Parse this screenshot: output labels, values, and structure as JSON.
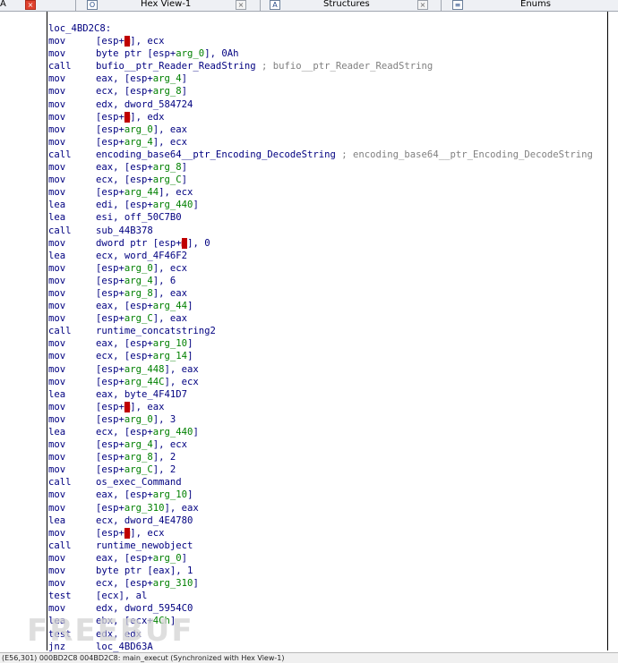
{
  "tabs": {
    "left": {
      "title": "A"
    },
    "hex": {
      "title": "Hex View-1",
      "icon_glyph": "O",
      "close_glyph": "×"
    },
    "structures": {
      "title": "Structures",
      "icon_glyph": "A",
      "close_glyph": "×"
    },
    "enums": {
      "title": "Enums",
      "icon_glyph": "≡"
    },
    "active_close_glyph": "×"
  },
  "colors": {
    "instruction": "#000080",
    "variable": "#008000",
    "comment": "#808080",
    "highlight": "#c00000"
  },
  "code": {
    "label": "loc_4BD2C8:",
    "instructions": [
      {
        "mnemonic": "mov",
        "operand": [
          [
            "p",
            "[esp+"
          ],
          [
            "m",
            "■"
          ],
          [
            "p",
            "], ecx"
          ]
        ]
      },
      {
        "mnemonic": "mov",
        "operand": [
          [
            "p",
            "byte ptr [esp+"
          ],
          [
            "v",
            "arg_0"
          ],
          [
            "p",
            "], 0Ah"
          ]
        ]
      },
      {
        "mnemonic": "call",
        "operand": [
          [
            "p",
            "bufio__ptr_Reader_ReadString "
          ],
          [
            "c",
            "; bufio__ptr_Reader_ReadString"
          ]
        ]
      },
      {
        "mnemonic": "mov",
        "operand": [
          [
            "p",
            "eax, [esp+"
          ],
          [
            "v",
            "arg_4"
          ],
          [
            "p",
            "]"
          ]
        ]
      },
      {
        "mnemonic": "mov",
        "operand": [
          [
            "p",
            "ecx, [esp+"
          ],
          [
            "v",
            "arg_8"
          ],
          [
            "p",
            "]"
          ]
        ]
      },
      {
        "mnemonic": "mov",
        "operand": [
          [
            "p",
            "edx, dword_584724"
          ]
        ]
      },
      {
        "mnemonic": "mov",
        "operand": [
          [
            "p",
            "[esp+"
          ],
          [
            "m",
            "■"
          ],
          [
            "p",
            "], edx"
          ]
        ]
      },
      {
        "mnemonic": "mov",
        "operand": [
          [
            "p",
            "[esp+"
          ],
          [
            "v",
            "arg_0"
          ],
          [
            "p",
            "], eax"
          ]
        ]
      },
      {
        "mnemonic": "mov",
        "operand": [
          [
            "p",
            "[esp+"
          ],
          [
            "v",
            "arg_4"
          ],
          [
            "p",
            "], ecx"
          ]
        ]
      },
      {
        "mnemonic": "call",
        "operand": [
          [
            "p",
            "encoding_base64__ptr_Encoding_DecodeString "
          ],
          [
            "c",
            "; encoding_base64__ptr_Encoding_DecodeString"
          ]
        ]
      },
      {
        "mnemonic": "mov",
        "operand": [
          [
            "p",
            "eax, [esp+"
          ],
          [
            "v",
            "arg_8"
          ],
          [
            "p",
            "]"
          ]
        ]
      },
      {
        "mnemonic": "mov",
        "operand": [
          [
            "p",
            "ecx, [esp+"
          ],
          [
            "v",
            "arg_C"
          ],
          [
            "p",
            "]"
          ]
        ]
      },
      {
        "mnemonic": "mov",
        "operand": [
          [
            "p",
            "[esp+"
          ],
          [
            "v",
            "arg_44"
          ],
          [
            "p",
            "], ecx"
          ]
        ]
      },
      {
        "mnemonic": "lea",
        "operand": [
          [
            "p",
            "edi, [esp+"
          ],
          [
            "v",
            "arg_440"
          ],
          [
            "p",
            "]"
          ]
        ]
      },
      {
        "mnemonic": "lea",
        "operand": [
          [
            "p",
            "esi, off_50C7B0"
          ]
        ]
      },
      {
        "mnemonic": "call",
        "operand": [
          [
            "p",
            "sub_44B378"
          ]
        ]
      },
      {
        "mnemonic": "mov",
        "operand": [
          [
            "p",
            "dword ptr [esp+"
          ],
          [
            "m",
            "■"
          ],
          [
            "p",
            "], 0"
          ]
        ]
      },
      {
        "mnemonic": "lea",
        "operand": [
          [
            "p",
            "ecx, word_4F46F2"
          ]
        ]
      },
      {
        "mnemonic": "mov",
        "operand": [
          [
            "p",
            "[esp+"
          ],
          [
            "v",
            "arg_0"
          ],
          [
            "p",
            "], ecx"
          ]
        ]
      },
      {
        "mnemonic": "mov",
        "operand": [
          [
            "p",
            "[esp+"
          ],
          [
            "v",
            "arg_4"
          ],
          [
            "p",
            "], 6"
          ]
        ]
      },
      {
        "mnemonic": "mov",
        "operand": [
          [
            "p",
            "[esp+"
          ],
          [
            "v",
            "arg_8"
          ],
          [
            "p",
            "], eax"
          ]
        ]
      },
      {
        "mnemonic": "mov",
        "operand": [
          [
            "p",
            "eax, [esp+"
          ],
          [
            "v",
            "arg_44"
          ],
          [
            "p",
            "]"
          ]
        ]
      },
      {
        "mnemonic": "mov",
        "operand": [
          [
            "p",
            "[esp+"
          ],
          [
            "v",
            "arg_C"
          ],
          [
            "p",
            "], eax"
          ]
        ]
      },
      {
        "mnemonic": "call",
        "operand": [
          [
            "p",
            "runtime_concatstring2"
          ]
        ]
      },
      {
        "mnemonic": "mov",
        "operand": [
          [
            "p",
            "eax, [esp+"
          ],
          [
            "v",
            "arg_10"
          ],
          [
            "p",
            "]"
          ]
        ]
      },
      {
        "mnemonic": "mov",
        "operand": [
          [
            "p",
            "ecx, [esp+"
          ],
          [
            "v",
            "arg_14"
          ],
          [
            "p",
            "]"
          ]
        ]
      },
      {
        "mnemonic": "mov",
        "operand": [
          [
            "p",
            "[esp+"
          ],
          [
            "v",
            "arg_448"
          ],
          [
            "p",
            "], eax"
          ]
        ]
      },
      {
        "mnemonic": "mov",
        "operand": [
          [
            "p",
            "[esp+"
          ],
          [
            "v",
            "arg_44C"
          ],
          [
            "p",
            "], ecx"
          ]
        ]
      },
      {
        "mnemonic": "lea",
        "operand": [
          [
            "p",
            "eax, byte_4F41D7"
          ]
        ]
      },
      {
        "mnemonic": "mov",
        "operand": [
          [
            "p",
            "[esp+"
          ],
          [
            "m",
            "■"
          ],
          [
            "p",
            "], eax"
          ]
        ]
      },
      {
        "mnemonic": "mov",
        "operand": [
          [
            "p",
            "[esp+"
          ],
          [
            "v",
            "arg_0"
          ],
          [
            "p",
            "], 3"
          ]
        ]
      },
      {
        "mnemonic": "lea",
        "operand": [
          [
            "p",
            "ecx, [esp+"
          ],
          [
            "v",
            "arg_440"
          ],
          [
            "p",
            "]"
          ]
        ]
      },
      {
        "mnemonic": "mov",
        "operand": [
          [
            "p",
            "[esp+"
          ],
          [
            "v",
            "arg_4"
          ],
          [
            "p",
            "], ecx"
          ]
        ]
      },
      {
        "mnemonic": "mov",
        "operand": [
          [
            "p",
            "[esp+"
          ],
          [
            "v",
            "arg_8"
          ],
          [
            "p",
            "], 2"
          ]
        ]
      },
      {
        "mnemonic": "mov",
        "operand": [
          [
            "p",
            "[esp+"
          ],
          [
            "v",
            "arg_C"
          ],
          [
            "p",
            "], 2"
          ]
        ]
      },
      {
        "mnemonic": "call",
        "operand": [
          [
            "p",
            "os_exec_Command"
          ]
        ]
      },
      {
        "mnemonic": "mov",
        "operand": [
          [
            "p",
            "eax, [esp+"
          ],
          [
            "v",
            "arg_10"
          ],
          [
            "p",
            "]"
          ]
        ]
      },
      {
        "mnemonic": "mov",
        "operand": [
          [
            "p",
            "[esp+"
          ],
          [
            "v",
            "arg_310"
          ],
          [
            "p",
            "], eax"
          ]
        ]
      },
      {
        "mnemonic": "lea",
        "operand": [
          [
            "p",
            "ecx, dword_4E4780"
          ]
        ]
      },
      {
        "mnemonic": "mov",
        "operand": [
          [
            "p",
            "[esp+"
          ],
          [
            "m",
            "■"
          ],
          [
            "p",
            "], ecx"
          ]
        ]
      },
      {
        "mnemonic": "call",
        "operand": [
          [
            "p",
            "runtime_newobject"
          ]
        ]
      },
      {
        "mnemonic": "mov",
        "operand": [
          [
            "p",
            "eax, [esp+"
          ],
          [
            "v",
            "arg_0"
          ],
          [
            "p",
            "]"
          ]
        ]
      },
      {
        "mnemonic": "mov",
        "operand": [
          [
            "p",
            "byte ptr [eax], 1"
          ]
        ]
      },
      {
        "mnemonic": "mov",
        "operand": [
          [
            "p",
            "ecx, [esp+"
          ],
          [
            "v",
            "arg_310"
          ],
          [
            "p",
            "]"
          ]
        ]
      },
      {
        "mnemonic": "test",
        "operand": [
          [
            "p",
            "[ecx], al"
          ]
        ]
      },
      {
        "mnemonic": "mov",
        "operand": [
          [
            "p",
            "edx, dword_5954C0"
          ]
        ]
      },
      {
        "mnemonic": "lea",
        "operand": [
          [
            "p",
            "ebx, [ecx+"
          ],
          [
            "v",
            "4Ch"
          ],
          [
            "p",
            "]"
          ]
        ]
      },
      {
        "mnemonic": "test",
        "operand": [
          [
            "p",
            "edx, edx"
          ]
        ]
      },
      {
        "mnemonic": "jnz",
        "operand": [
          [
            "p",
            "loc_4BD63A"
          ]
        ]
      }
    ]
  },
  "statusbar": {
    "text": "(E56,301) 000BD2C8 004BD2C8: main_execut (Synchronized with Hex View-1)"
  },
  "watermark": {
    "text": "FREEBUF"
  }
}
